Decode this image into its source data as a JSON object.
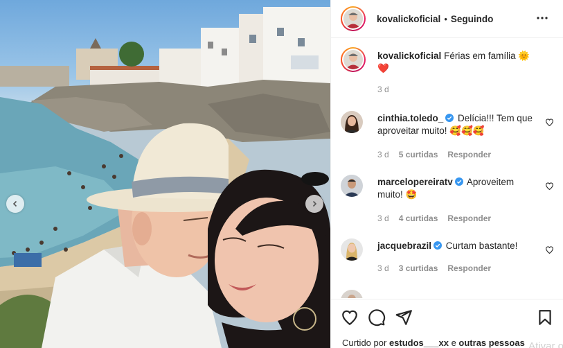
{
  "post": {
    "author": "kovalickoficial",
    "follow_status": "Seguindo",
    "separator": "•",
    "caption_text": "Férias em família",
    "caption_time": "3 d"
  },
  "comments": [
    {
      "user": "cinthia.toledo_",
      "verified": true,
      "text": "Delícia!!! Tem que aproveitar muito! 🥰🥰🥰",
      "time": "3 d",
      "likes": "5 curtidas",
      "reply": "Responder"
    },
    {
      "user": "marcelopereiratv",
      "verified": true,
      "text": "Aproveitem muito! 🤩",
      "time": "3 d",
      "likes": "4 curtidas",
      "reply": "Responder"
    },
    {
      "user": "jacquebrazil",
      "verified": true,
      "text": "Curtam bastante!",
      "time": "3 d",
      "likes": "3 curtidas",
      "reply": "Responder"
    }
  ],
  "liked_by": {
    "prefix": "Curtido por",
    "user": "estudos___xx",
    "middle": "e",
    "others": "outras pessoas"
  },
  "watermark": "Ativar o",
  "icons": {
    "more": "more-icon",
    "like": "heart-icon",
    "comment": "comment-icon",
    "share": "send-icon",
    "save": "bookmark-icon",
    "prev": "chevron-left-icon",
    "next": "chevron-right-icon",
    "verified": "verified-badge-icon"
  },
  "colors": {
    "verified": "#3897f0",
    "text": "#262626",
    "muted": "#8e8e8e",
    "divider": "#efefef"
  }
}
